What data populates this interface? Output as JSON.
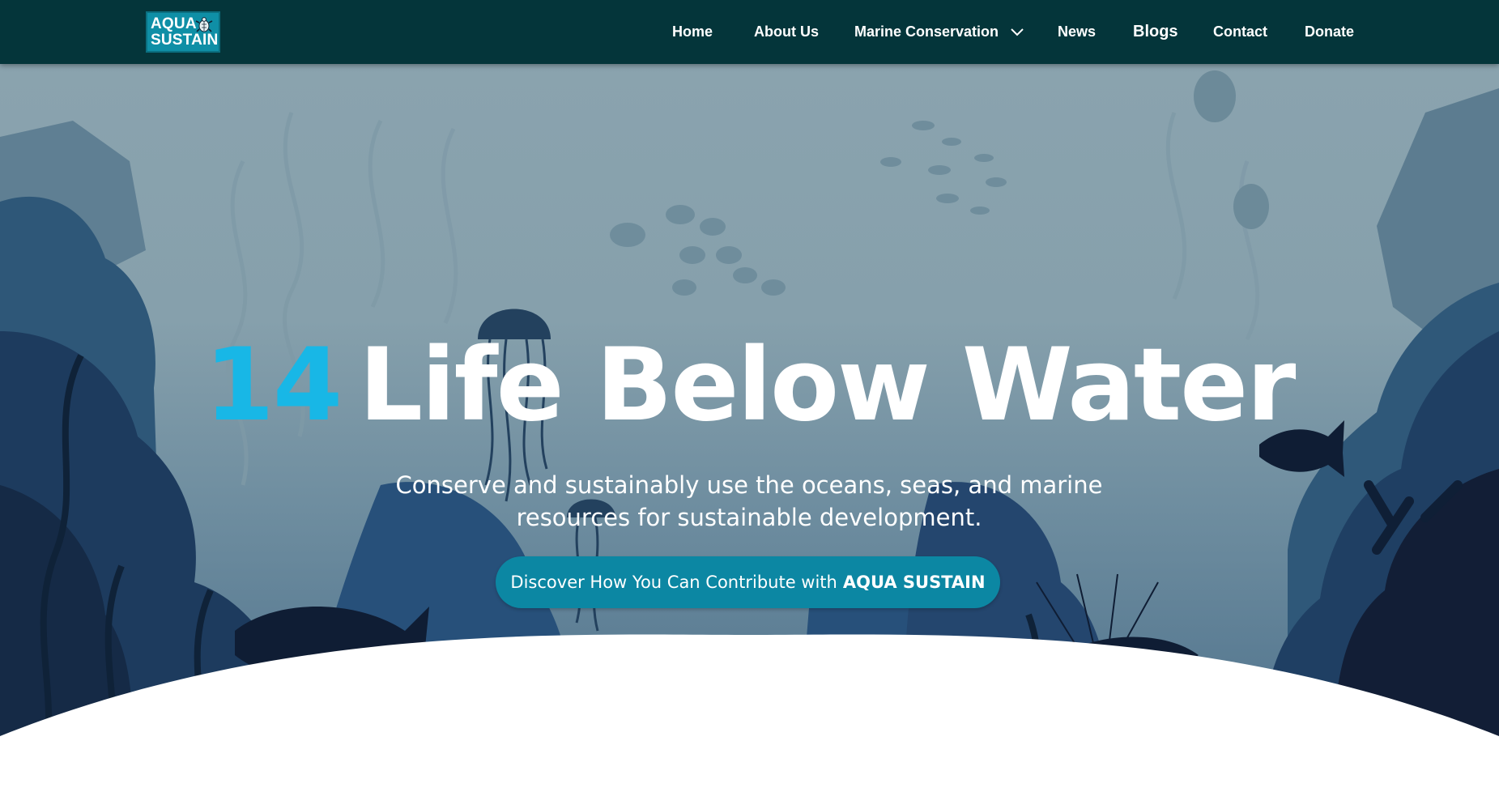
{
  "logo": {
    "line1": "AQUA",
    "line2": "SUSTAIN"
  },
  "nav": {
    "items": [
      {
        "label": "Home"
      },
      {
        "label": "About Us"
      },
      {
        "label": "Marine Conservation"
      },
      {
        "label": "News"
      },
      {
        "label": "Blogs"
      },
      {
        "label": "Contact"
      },
      {
        "label": "Donate"
      }
    ]
  },
  "hero": {
    "number": "14",
    "title": "Life Below Water",
    "subtitle": "Conserve and sustainably use the oceans, seas, and marine resources for sustainable development.",
    "cta_text": "Discover How You Can Contribute with",
    "cta_brand": "AQUA SUSTAIN"
  },
  "colors": {
    "navbar": "#04353a",
    "accent_number": "#18b7e6",
    "cta": "#0c87a3"
  }
}
